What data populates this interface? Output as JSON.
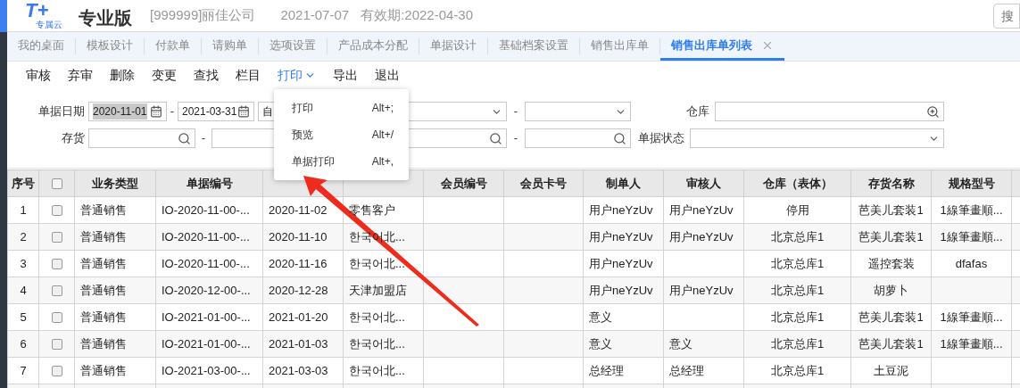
{
  "header": {
    "logo_mark": "T+",
    "logo_sub": "专属云",
    "edition": "专业版",
    "company": "[999999]丽佳公司",
    "date": "2021-07-07",
    "validity": "有效期:2022-04-30",
    "search_placeholder": "搜"
  },
  "tabs": [
    {
      "label": "我的桌面",
      "selected": false
    },
    {
      "label": "模板设计",
      "selected": false
    },
    {
      "label": "付款单",
      "selected": false
    },
    {
      "label": "请购单",
      "selected": false
    },
    {
      "label": "选项设置",
      "selected": false
    },
    {
      "label": "产品成本分配",
      "selected": false
    },
    {
      "label": "单据设计",
      "selected": false
    },
    {
      "label": "基础档案设置",
      "selected": false
    },
    {
      "label": "销售出库单",
      "selected": false
    },
    {
      "label": "销售出库单列表",
      "selected": true
    }
  ],
  "toolbar": [
    {
      "label": "审核",
      "kind": "button"
    },
    {
      "label": "弃审",
      "kind": "button"
    },
    {
      "label": "删除",
      "kind": "button"
    },
    {
      "label": "变更",
      "kind": "button"
    },
    {
      "label": "查找",
      "kind": "button"
    },
    {
      "label": "栏目",
      "kind": "button"
    },
    {
      "label": "打印",
      "kind": "dropdown",
      "expanded": true
    },
    {
      "label": "导出",
      "kind": "button"
    },
    {
      "label": "退出",
      "kind": "button"
    }
  ],
  "print_menu": [
    {
      "label": "打印",
      "shortcut": "Alt+;"
    },
    {
      "label": "预览",
      "shortcut": "Alt+/"
    },
    {
      "label": "单据打印",
      "shortcut": "Alt+,"
    }
  ],
  "filters": [
    [
      {
        "kind": "label",
        "text": "单据日期"
      },
      {
        "kind": "date",
        "value": "2020-11-01",
        "highlighted": true
      },
      {
        "kind": "dash",
        "text": "-"
      },
      {
        "kind": "date",
        "value": "2021-03-31",
        "highlighted": false
      },
      {
        "kind": "select",
        "value": "自"
      },
      {
        "kind": "select"
      },
      {
        "kind": "dash",
        "text": "-"
      },
      {
        "kind": "select"
      },
      {
        "kind": "label",
        "text": "仓库"
      },
      {
        "kind": "lookup"
      }
    ],
    [
      {
        "kind": "label",
        "text": "存货"
      },
      {
        "kind": "search"
      },
      {
        "kind": "dash",
        "text": "-"
      },
      {
        "kind": "text"
      },
      {
        "kind": "search"
      },
      {
        "kind": "dash",
        "text": "-"
      },
      {
        "kind": "search"
      },
      {
        "kind": "label",
        "text": "单据状态"
      },
      {
        "kind": "select"
      }
    ]
  ],
  "table": {
    "columns": [
      {
        "kind": "text",
        "label": "序号"
      },
      {
        "kind": "checkbox",
        "checked": false
      },
      {
        "kind": "text",
        "label": "业务类型"
      },
      {
        "kind": "text",
        "label": "单据编号"
      },
      {
        "kind": "covered"
      },
      {
        "kind": "covered"
      },
      {
        "kind": "text",
        "label": "会员编号"
      },
      {
        "kind": "text",
        "label": "会员卡号"
      },
      {
        "kind": "text",
        "label": "制单人"
      },
      {
        "kind": "text",
        "label": "审核人"
      },
      {
        "kind": "text",
        "label": "仓库（表体）"
      },
      {
        "kind": "text",
        "label": "存货名称"
      },
      {
        "kind": "text",
        "label": "规格型号"
      },
      {
        "kind": "covered"
      }
    ],
    "rows": [
      {
        "no": "1",
        "checked": false,
        "type": "普通销售",
        "doc_no": "IO-2020-11-00-...",
        "date": "2020-11-02",
        "customer": "零售客户",
        "maker": "用户neYzUv",
        "reviewer": "用户neYzUv",
        "warehouse": "停用",
        "item": "芭美儿套装1",
        "spec": "1線筆畫順..."
      },
      {
        "no": "2",
        "checked": false,
        "type": "普通销售",
        "doc_no": "IO-2020-11-00-...",
        "date": "2020-11-10",
        "customer": "한국어北...",
        "maker": "用户neYzUv",
        "reviewer": "用户neYzUv",
        "warehouse": "北京总库1",
        "item": "芭美儿套装1",
        "spec": "1線筆畫順..."
      },
      {
        "no": "3",
        "checked": false,
        "type": "普通销售",
        "doc_no": "IO-2020-11-00-...",
        "date": "2020-11-16",
        "customer": "한국어北...",
        "maker": "用户neYzUv",
        "warehouse": "北京总库1",
        "item": "遥控套装",
        "spec": "dfafas"
      },
      {
        "no": "4",
        "checked": false,
        "type": "普通销售",
        "doc_no": "IO-2020-12-00-...",
        "date": "2020-12-28",
        "customer": "天津加盟店",
        "maker": "用户neYzUv",
        "reviewer": "用户neYzUv",
        "warehouse": "北京总库1",
        "item": "胡萝卜"
      },
      {
        "no": "5",
        "checked": false,
        "type": "普通销售",
        "doc_no": "IO-2021-01-00-...",
        "date": "2021-01-20",
        "customer": "한국어北...",
        "maker": "意义",
        "warehouse": "北京总库1",
        "item": "芭美儿套装1",
        "spec": "1線筆畫順..."
      },
      {
        "no": "6",
        "checked": false,
        "type": "普通销售",
        "doc_no": "IO-2021-01-00-...",
        "date": "2021-01-03",
        "customer": "한국어北...",
        "maker": "意义",
        "reviewer": "意义",
        "warehouse": "北京总库1",
        "item": "芭美儿套装1",
        "spec": "1線筆畫順..."
      },
      {
        "no": "7",
        "checked": false,
        "type": "普通销售",
        "doc_no": "IO-2021-03-00-...",
        "date": "2021-03-03",
        "customer": "한국어北...",
        "maker": "总经理",
        "reviewer": "总经理",
        "warehouse": "北京总库1",
        "item": "土豆泥"
      }
    ]
  }
}
